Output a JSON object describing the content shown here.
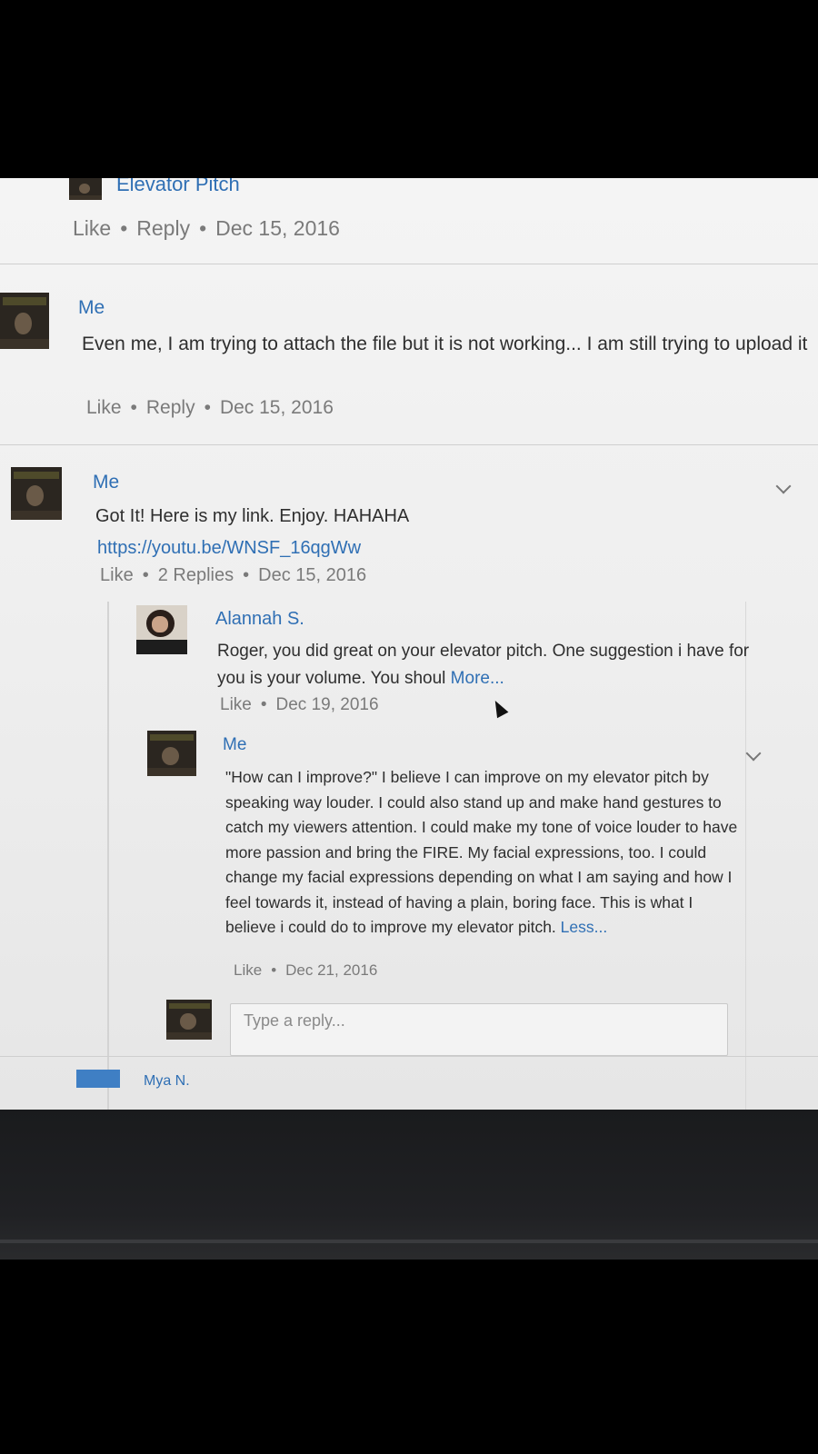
{
  "post": {
    "title": "Elevator Pitch",
    "like": "Like",
    "reply": "Reply",
    "date": "Dec 15, 2016"
  },
  "comments": [
    {
      "author": "Me",
      "text": "Even me, I am trying to attach the file but it is not working... I am still trying to upload it",
      "like": "Like",
      "reply": "Reply",
      "date": "Dec 15, 2016"
    },
    {
      "author": "Me",
      "text": "Got It! Here is my link. Enjoy. HAHAHA",
      "link": "https://youtu.be/WNSF_16qgWw",
      "like": "Like",
      "replies": "2 Replies",
      "date": "Dec 15, 2016",
      "thread": [
        {
          "author": "Alannah S.",
          "text": "Roger, you did great on your elevator pitch. One suggestion i have for you is your volume. You shoul",
          "more": "More...",
          "like": "Like",
          "date": "Dec 19, 2016"
        },
        {
          "author": "Me",
          "text": "\"How can I improve?\" I believe I can improve on my elevator pitch by speaking way louder. I could also stand up and make hand gestures to catch my viewers attention. I could make my tone of voice louder to have more passion and bring the FIRE. My facial expressions, too. I could change my facial expressions depending on what I am saying and how I feel towards it, instead of having a plain, boring face. This is what I believe i could do to improve my elevator pitch.",
          "less": "Less...",
          "like": "Like",
          "date": "Dec 21, 2016"
        }
      ],
      "reply_placeholder": "Type a reply..."
    },
    {
      "author": "Mya N."
    }
  ]
}
